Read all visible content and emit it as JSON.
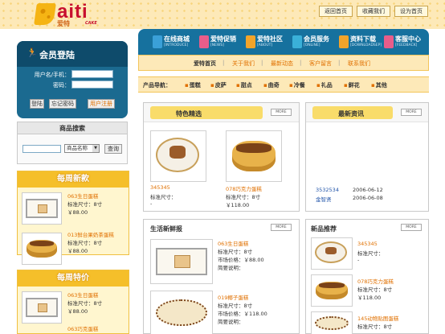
{
  "header": {
    "logo_text": "aiti",
    "logo_cn": "爱特",
    "logo_sub": "CAKE",
    "links": [
      "返回首页",
      "收藏我们",
      "设为首页"
    ]
  },
  "login": {
    "title": "会员登陆",
    "username_label": "用户名/手机：",
    "password_label": "密码：",
    "buttons": [
      "登陆",
      "忘记密码",
      "用户注册"
    ]
  },
  "search": {
    "title": "商品搜索",
    "select_value": "商品名称",
    "button": "查询"
  },
  "weekly_new": {
    "title": "每周新款",
    "items": [
      {
        "name": "063生日蛋糕",
        "size": "标准尺寸：8寸",
        "price": "￥88.00"
      },
      {
        "name": "013鲜台果奶茶蛋糕",
        "size": "标准尺寸：8寸",
        "price": "￥88.00"
      }
    ]
  },
  "weekly_special": {
    "title": "每周特价",
    "items": [
      {
        "name": "063生日蛋糕",
        "size": "标准尺寸：8寸",
        "price": "￥88.00"
      },
      {
        "name": "063巧克蛋糕",
        "size": "",
        "price": ""
      }
    ]
  },
  "nav": {
    "items": [
      {
        "label": "在线商城",
        "sub": "[INTRODUCE]",
        "color": "#3aa0d8"
      },
      {
        "label": "爱特促销",
        "sub": "[NEWS]",
        "color": "#e85d8a"
      },
      {
        "label": "爱特社区",
        "sub": "[ABOUT]",
        "color": "#f2a42a"
      },
      {
        "label": "会员服务",
        "sub": "[ONLINE]",
        "color": "#3ab0d8"
      },
      {
        "label": "资料下载",
        "sub": "[DOWNLOADSEP]",
        "color": "#f2a42a"
      },
      {
        "label": "客服中心",
        "sub": "[FEEDBACK]",
        "color": "#e85d8a"
      }
    ]
  },
  "subnav": [
    "爱特首页",
    "关于我们",
    "最新动态",
    "客户留言",
    "联系我们"
  ],
  "categories": {
    "label": "产品导航：",
    "items": [
      "蛋糕",
      "皮萨",
      "甜点",
      "曲奇",
      "冷餐",
      "礼品",
      "鲜花",
      "其他"
    ]
  },
  "featured": {
    "title": "特色精选",
    "more": "MORE",
    "items": [
      {
        "name": "345345",
        "size": "标准尺寸：",
        "price": "-"
      },
      {
        "name": "078巧克力蛋糕",
        "size": "标准尺寸：8寸",
        "price": "￥118.00"
      }
    ]
  },
  "news": {
    "title": "最新资讯",
    "more": "MORE",
    "items": [
      {
        "title": "3532534",
        "date": "2006-06-12"
      },
      {
        "title": "金智贤",
        "date": "2006-06-08"
      }
    ]
  },
  "fresh": {
    "title": "生活新鲜报",
    "more": "MORE",
    "items": [
      {
        "name": "063生日蛋糕",
        "size": "标准尺寸：8寸",
        "price": "市场价格：￥88.00",
        "desc": "简要说明："
      },
      {
        "name": "019椰子蛋糕",
        "size": "标准尺寸：8寸",
        "price": "市场价格：￥118.00",
        "desc": "简要说明："
      }
    ]
  },
  "new_products": {
    "title": "新品推荐",
    "more": "MORE",
    "items": [
      {
        "name": "345345",
        "size": "标准尺寸：",
        "price": "-"
      },
      {
        "name": "078巧克力蛋糕",
        "size": "标准尺寸：8寸",
        "price": "￥118.00"
      },
      {
        "name": "145动物贴图蛋糕",
        "size": "标准尺寸：8寸",
        "price": ""
      }
    ]
  }
}
